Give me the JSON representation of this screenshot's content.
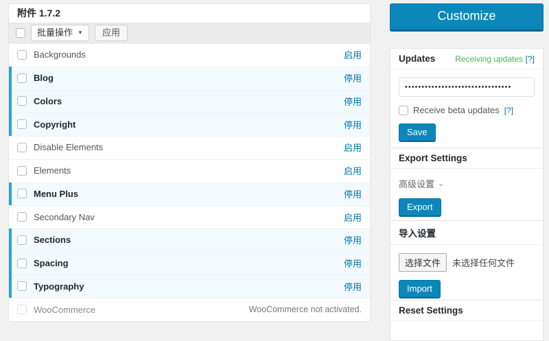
{
  "colors": {
    "page_bg": "#f1f1f1",
    "primary_blue": "#0b87ba",
    "link_blue": "#0073aa",
    "active_bg": "#f2fafd",
    "active_border": "#2ea2cc",
    "success_green": "#46b450"
  },
  "icons": {
    "dropdown_arrow": "▼",
    "chevron_down": "⌄"
  },
  "addons": {
    "title": "附件 1.7.2",
    "toolbar": {
      "bulk_action_label": "批量操作",
      "apply_label": "应用"
    },
    "rows": [
      {
        "name": "Backgrounds",
        "active": false,
        "action": "启用"
      },
      {
        "name": "Blog",
        "active": true,
        "action": "停用"
      },
      {
        "name": "Colors",
        "active": true,
        "action": "停用"
      },
      {
        "name": "Copyright",
        "active": true,
        "action": "停用"
      },
      {
        "name": "Disable Elements",
        "active": false,
        "action": "启用"
      },
      {
        "name": "Elements",
        "active": false,
        "action": "启用"
      },
      {
        "name": "Menu Plus",
        "active": true,
        "action": "停用"
      },
      {
        "name": "Secondary Nav",
        "active": false,
        "action": "启用"
      },
      {
        "name": "Sections",
        "active": true,
        "action": "停用"
      },
      {
        "name": "Spacing",
        "active": true,
        "action": "停用"
      },
      {
        "name": "Typography",
        "active": true,
        "action": "停用"
      },
      {
        "name": "WooCommerce",
        "active": false,
        "disabled": true,
        "status": "WooCommerce not activated."
      }
    ]
  },
  "sidebar": {
    "customize_label": "Customize",
    "updates": {
      "title": "Updates",
      "status_link": "Receiving updates",
      "status_help": "[?]",
      "license_value": "••••••••••••••••••••••••••••••••",
      "beta_label": "Receive beta updates",
      "beta_help": "[?]",
      "save_label": "Save"
    },
    "export": {
      "title": "Export Settings",
      "advanced_label": "高级设置",
      "export_label": "Export"
    },
    "import": {
      "title": "导入设置",
      "choose_file_label": "选择文件",
      "no_file_text": "未选择任何文件",
      "import_label": "Import"
    },
    "reset": {
      "title": "Reset Settings"
    }
  }
}
